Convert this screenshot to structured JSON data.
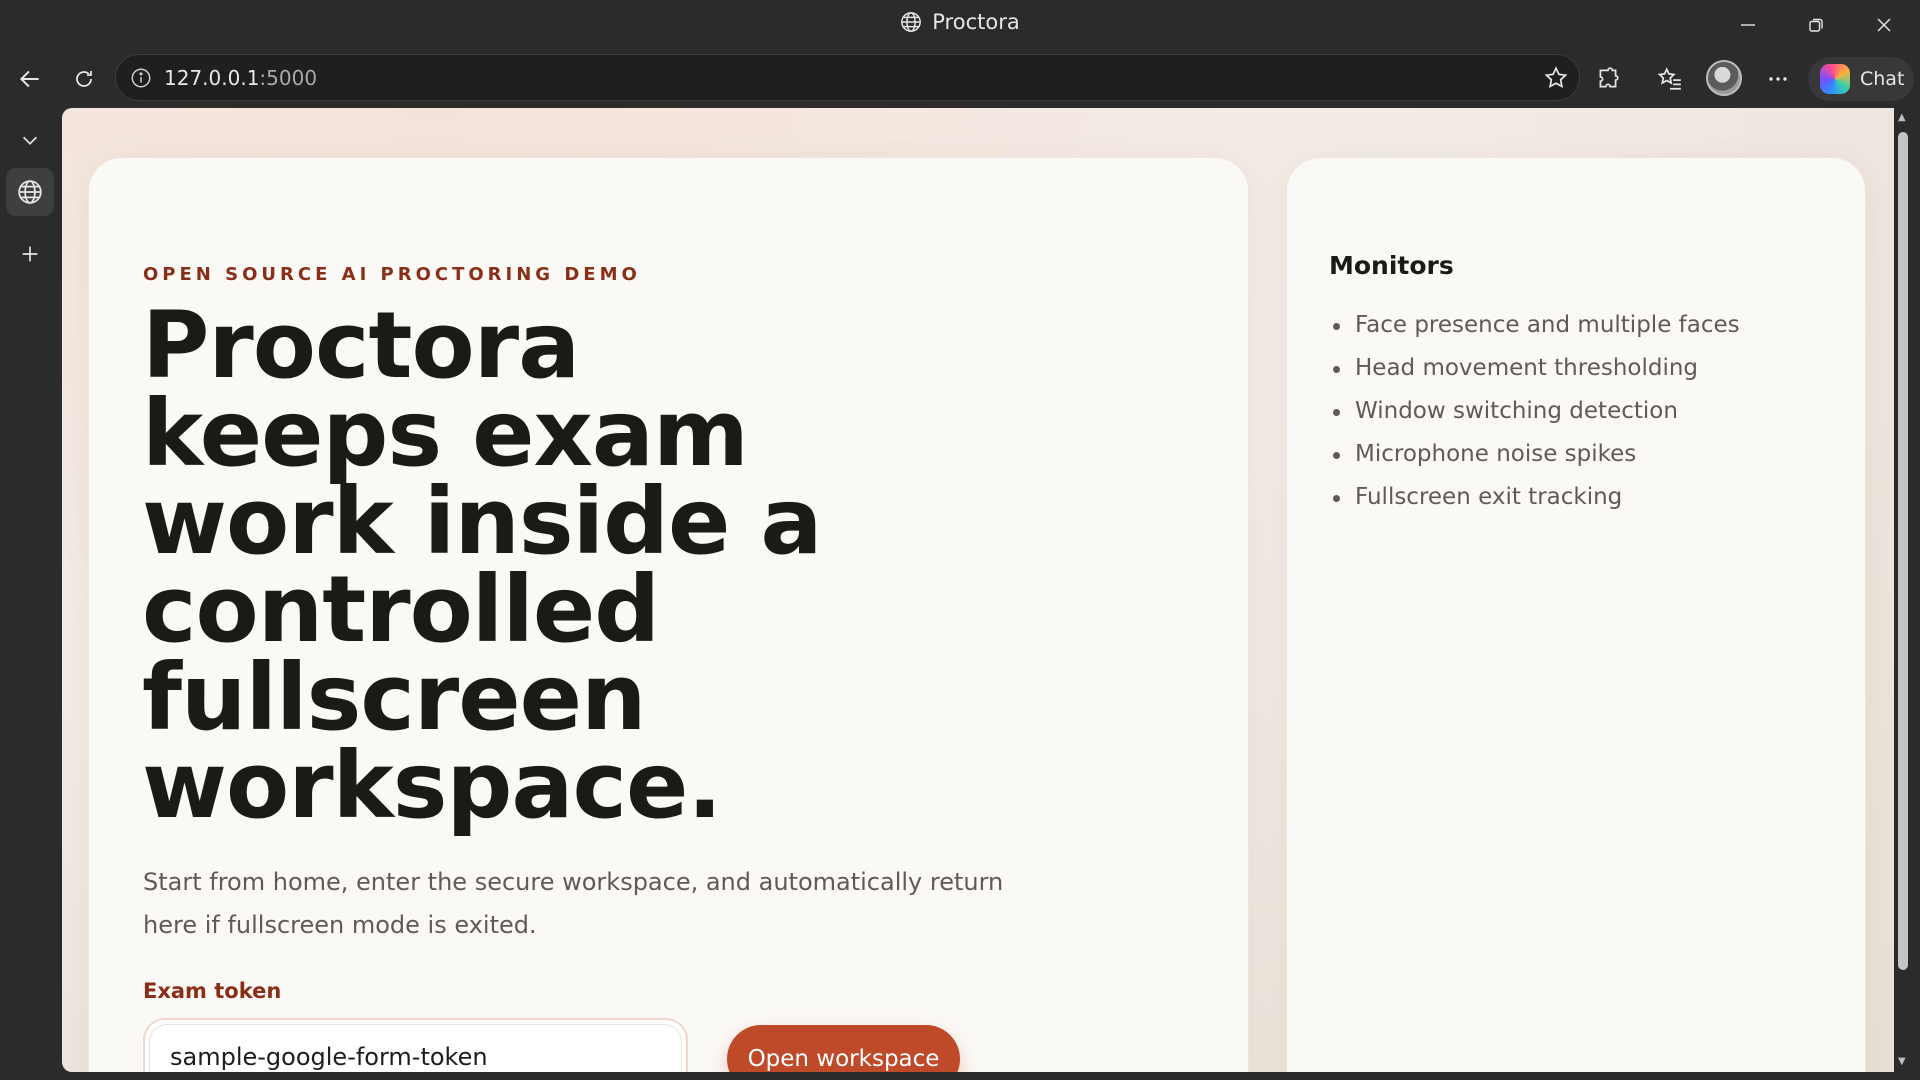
{
  "window": {
    "title": "Proctora",
    "controls": [
      "minimize",
      "restore",
      "close"
    ]
  },
  "toolbar": {
    "url_host": "127.0.0.1",
    "url_port": ":5000",
    "chat_label": "Chat"
  },
  "page": {
    "eyebrow": "OPEN SOURCE AI PROCTORING DEMO",
    "headline": "Proctora keeps exam work inside a controlled fullscreen workspace.",
    "lead": "Start from home, enter the secure workspace, and automatically return here if fullscreen mode is exited.",
    "token_label": "Exam token",
    "token_value": "sample-google-form-token",
    "open_button": "Open workspace"
  },
  "monitors": {
    "title": "Monitors",
    "items": [
      "Face presence and multiple faces",
      "Head movement thresholding",
      "Window switching detection",
      "Microphone noise spikes",
      "Fullscreen exit tracking"
    ]
  },
  "colors": {
    "accent": "#bf4a2a",
    "eyebrow": "#8a2f17",
    "chrome": "#2b2b2b"
  }
}
